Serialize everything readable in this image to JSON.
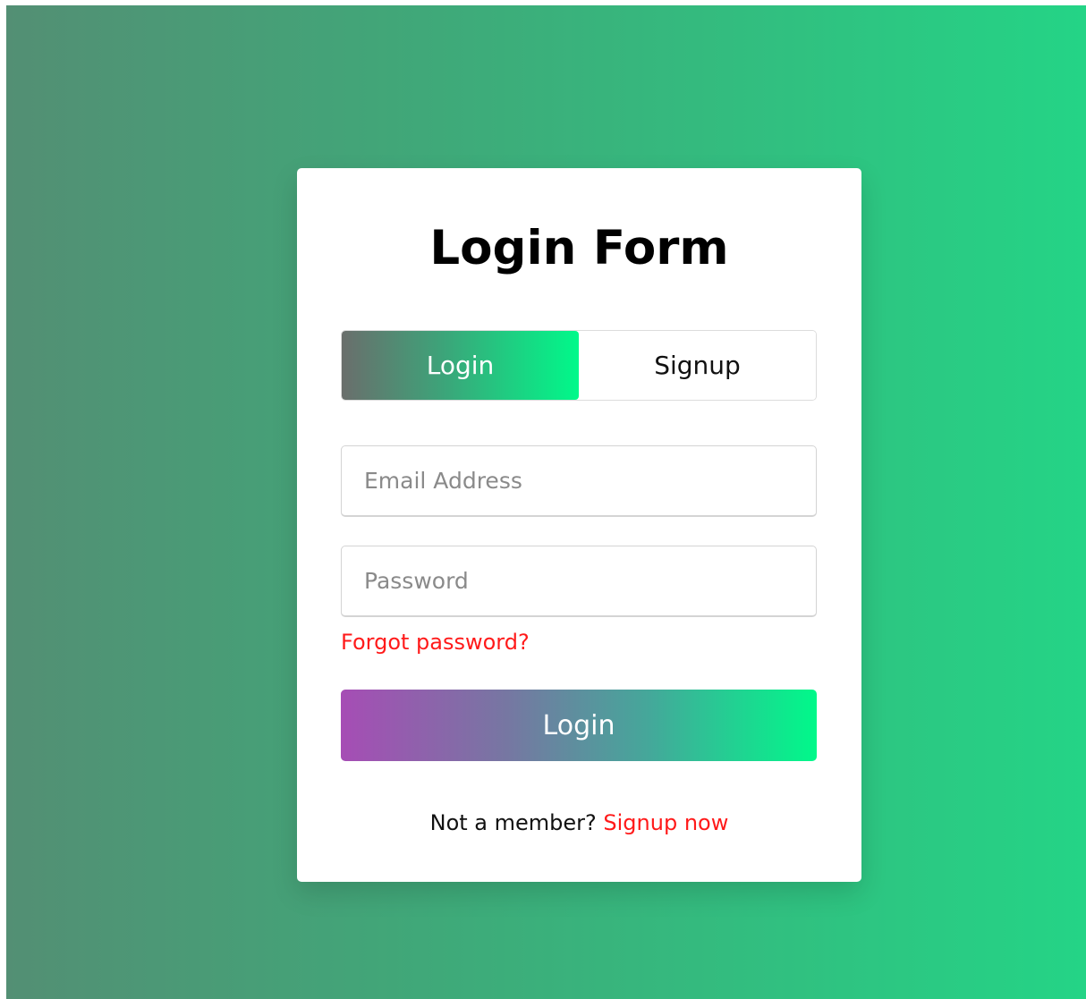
{
  "form": {
    "title": "Login Form",
    "tabs": [
      {
        "label": "Login",
        "active": true
      },
      {
        "label": "Signup",
        "active": false
      }
    ],
    "email": {
      "placeholder": "Email Address",
      "value": ""
    },
    "password": {
      "placeholder": "Password",
      "value": ""
    },
    "forgot_label": "Forgot password?",
    "submit_label": "Login",
    "footer": {
      "prompt": "Not a member?",
      "link_label": "Signup now"
    }
  },
  "colors": {
    "background_left": "#538f74",
    "background_right": "#24d486",
    "link": "#ff1a1a",
    "tab_gradient_start": "#6a6e6c",
    "tab_gradient_end": "#00f98a",
    "button_gradient_start": "#a64db5",
    "button_gradient_end": "#00f98a"
  }
}
